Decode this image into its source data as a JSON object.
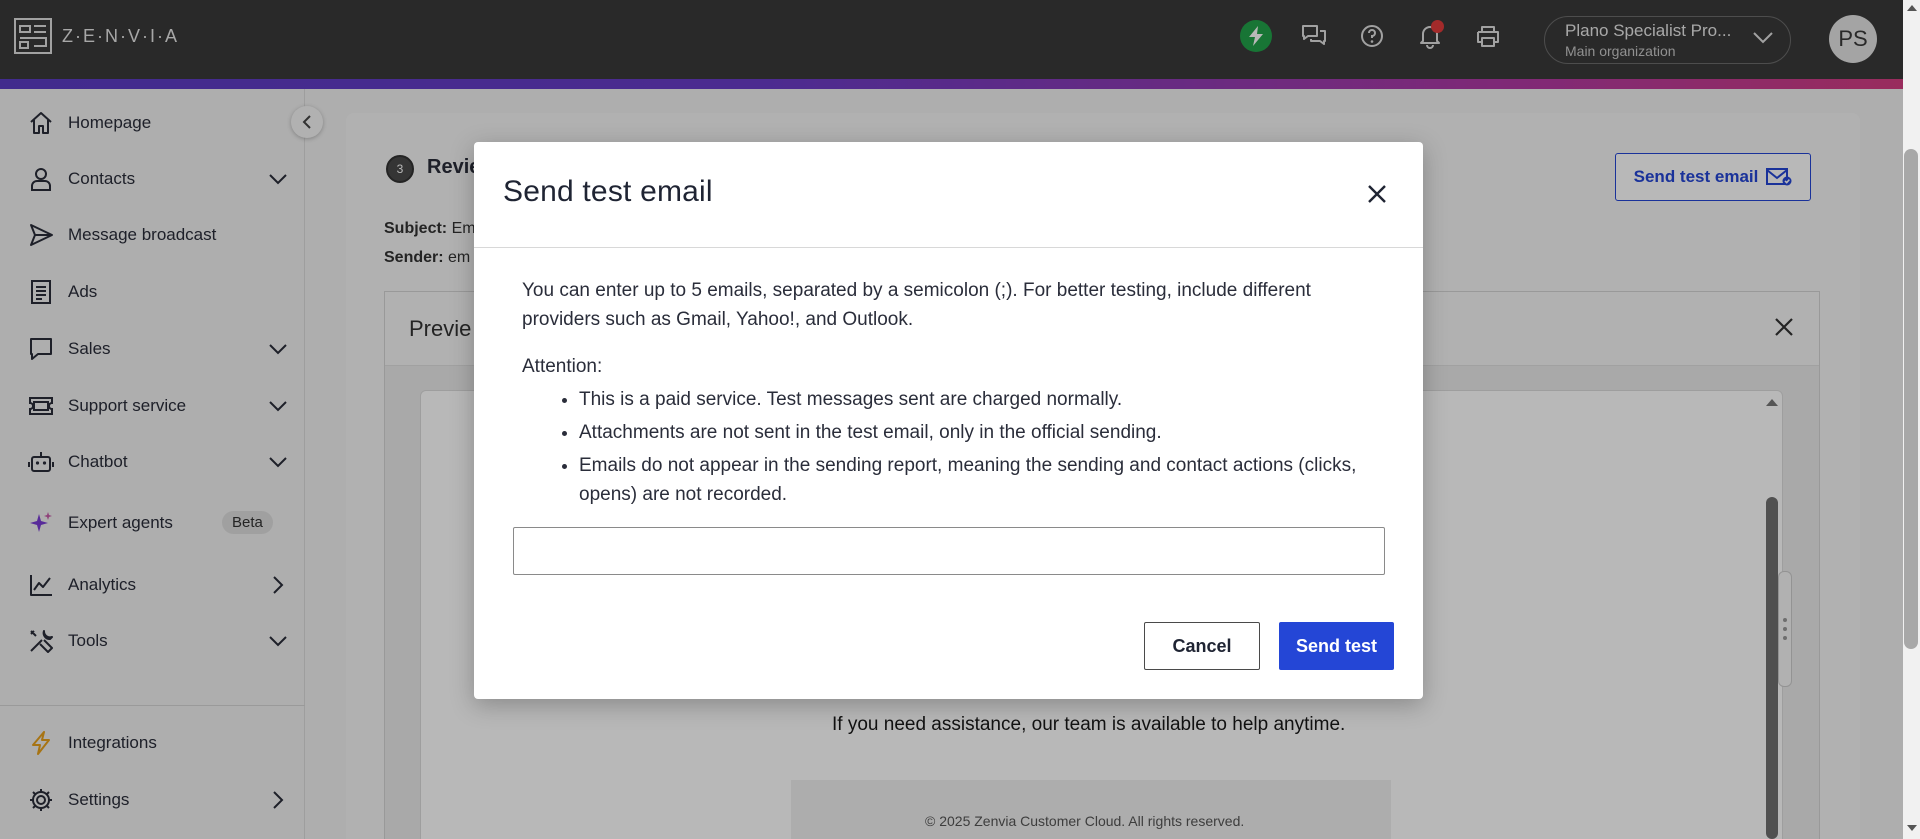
{
  "brand": {
    "name": "Z·E·N·V·I·A",
    "logo_icon": "zenvia-logo-icon"
  },
  "topbar": {
    "icons": [
      "bolt-icon",
      "chat-icon",
      "help-icon",
      "bell-icon",
      "printer-icon"
    ],
    "org_name": "Plano Specialist Pro...",
    "org_sub": "Main organization",
    "avatar_initials": "PS"
  },
  "sidebar": {
    "items": [
      {
        "label": "Homepage",
        "icon": "home-icon",
        "chevron": ""
      },
      {
        "label": "Contacts",
        "icon": "person-icon",
        "chevron": "down"
      },
      {
        "label": "Message broadcast",
        "icon": "send-icon",
        "chevron": ""
      },
      {
        "label": "Ads",
        "icon": "document-icon",
        "chevron": ""
      },
      {
        "label": "Sales",
        "icon": "speech-bubble-icon",
        "chevron": "down"
      },
      {
        "label": "Support service",
        "icon": "ticket-icon",
        "chevron": "down"
      },
      {
        "label": "Chatbot",
        "icon": "robot-icon",
        "chevron": "down"
      },
      {
        "label": "Expert agents",
        "icon": "sparkle-icon",
        "chevron": "",
        "badge": "Beta"
      },
      {
        "label": "Analytics",
        "icon": "chart-line-icon",
        "chevron": "right"
      },
      {
        "label": "Tools",
        "icon": "tools-icon",
        "chevron": "down"
      },
      {
        "label": "Integrations",
        "icon": "lightning-icon",
        "chevron": ""
      },
      {
        "label": "Settings",
        "icon": "gear-icon",
        "chevron": "right"
      }
    ]
  },
  "main": {
    "step_number": "3",
    "step_title": "Revie",
    "subject_label": "Subject:",
    "subject_value": "Em",
    "sender_label": "Sender:",
    "sender_value": "em",
    "send_test_email_label": "Send test email",
    "preview_title": "Previe",
    "assist_text": "If you need assistance, our team is available to help anytime.",
    "footer_text": "© 2025 Zenvia Customer Cloud. All rights reserved."
  },
  "modal": {
    "title": "Send test email",
    "intro": "You can enter up to 5 emails, separated by a semicolon (;). For better testing, include different providers such as Gmail, Yahoo!, and Outlook.",
    "attention_label": "Attention:",
    "bullets": [
      "This is a paid service. Test messages sent are charged normally.",
      "Attachments are not sent in the test email, only in the official sending.",
      "Emails do not appear in the sending report, meaning the sending and contact actions (clicks, opens) are not recorded."
    ],
    "email_input_value": "",
    "cancel_label": "Cancel",
    "send_label": "Send test"
  },
  "colors": {
    "primary": "#2446d6",
    "topbar": "#3a3a3a",
    "bolt_green": "#22a34a",
    "notification_red": "#e23b3b",
    "sparkle_purple": "#7a3cd6",
    "integrations_orange": "#e8a11c"
  }
}
